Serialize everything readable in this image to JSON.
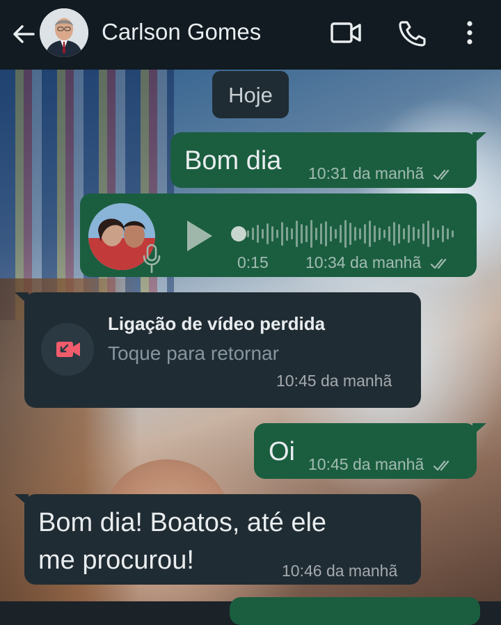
{
  "header": {
    "contact_name": "Carlson Gomes",
    "icons": [
      "back-arrow-icon",
      "video-call-icon",
      "voice-call-icon",
      "more-options-icon"
    ]
  },
  "chat": {
    "day_label": "Hoje",
    "messages": [
      {
        "type": "text",
        "direction": "outgoing",
        "text": "Bom dia",
        "time": "10:31 da manhã",
        "status": "read"
      },
      {
        "type": "voice",
        "direction": "outgoing",
        "duration": "0:15",
        "time": "10:34 da manhã",
        "status": "read",
        "progress": 0
      },
      {
        "type": "missed_call",
        "direction": "incoming",
        "title": "Ligação de vídeo perdida",
        "subtitle": "Toque para retornar",
        "time": "10:45 da manhã"
      },
      {
        "type": "text",
        "direction": "outgoing",
        "text": "Oi",
        "time": "10:45 da manhã",
        "status": "read"
      },
      {
        "type": "text",
        "direction": "incoming",
        "text_line1": "Bom dia! Boatos, até ele",
        "text_line2": "me procurou!",
        "time": "10:46 da manhã"
      }
    ]
  },
  "colors": {
    "header_bg": "#111b21",
    "outgoing_bubble": "#1b5e3f",
    "incoming_bubble": "#202c33",
    "missed_call_accent": "#f15c6d"
  }
}
